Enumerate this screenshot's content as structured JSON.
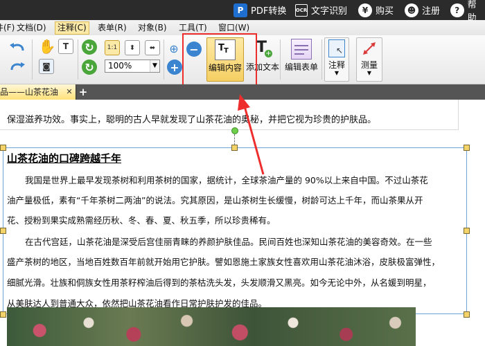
{
  "topbar": {
    "pdf_convert": "PDF转换",
    "ocr": "文字识别",
    "ocr_icon_text": "OCR",
    "buy": "购买",
    "register": "注册",
    "help": "帮助"
  },
  "menubar": {
    "items": [
      {
        "label": "件(F)"
      },
      {
        "label": "文档(D)"
      },
      {
        "label": "注释(C)"
      },
      {
        "label": "表单(R)"
      },
      {
        "label": "对象(B)"
      },
      {
        "label": "工具(T)"
      },
      {
        "label": "窗口(W)"
      }
    ]
  },
  "toolbar": {
    "zoom_value": "100%",
    "edit_content": "编辑内容",
    "add_text": "添加文本",
    "edit_form": "编辑表单",
    "annotate": "注释",
    "measure": "测量"
  },
  "tabs": {
    "doc_tab": "品——山茶花油"
  },
  "document": {
    "prev_text": "保湿滋养功效。事实上，聪明的古人早就发现了山茶花油的奥秘，并把它视为珍贵的护肤品。",
    "title": "山茶花油的口碑跨越千年",
    "p1_l1": "我国是世界上最早发现茶树和利用茶树的国家，据统计，全球茶油产量的 90%以上来自中国。不过山茶花",
    "p1_l2": "油产量极低，素有“千年茶树二两油”的说法。究其原因，是山茶树生长缓慢，树龄可达上千年，而山茶果从开",
    "p1_l3": "花、授粉到果实成熟需经历秋、冬、春、夏、秋五季，所以珍贵稀有。",
    "p2_l1": "在古代宫廷，山茶花油是深受后宫佳丽青睐的养颜护肤佳品。民间百姓也深知山茶花油的美容奇效。在一些",
    "p2_l2": "盛产茶树的地区，当地百姓数百年前就开始用它护肤。譬如恩施土家族女性喜欢用山茶花油沐浴，皮肤极富弹性，",
    "p2_l3": "细腻光滑。壮族和侗族女性用茶籽榨油后得到的茶枯洗头发，头发顺滑又黑亮。如今无论中外，从名媛到明星，",
    "p2_l4": "从美肤达人到普通大众，依然把山茶花油看作日常护肤护发的佳品。"
  },
  "colors": {
    "highlight_red": "#ee2d2d",
    "selection_blue": "#6ea2db",
    "handle_yellow": "#f3d36a",
    "active_tab": "#ffe27a"
  }
}
